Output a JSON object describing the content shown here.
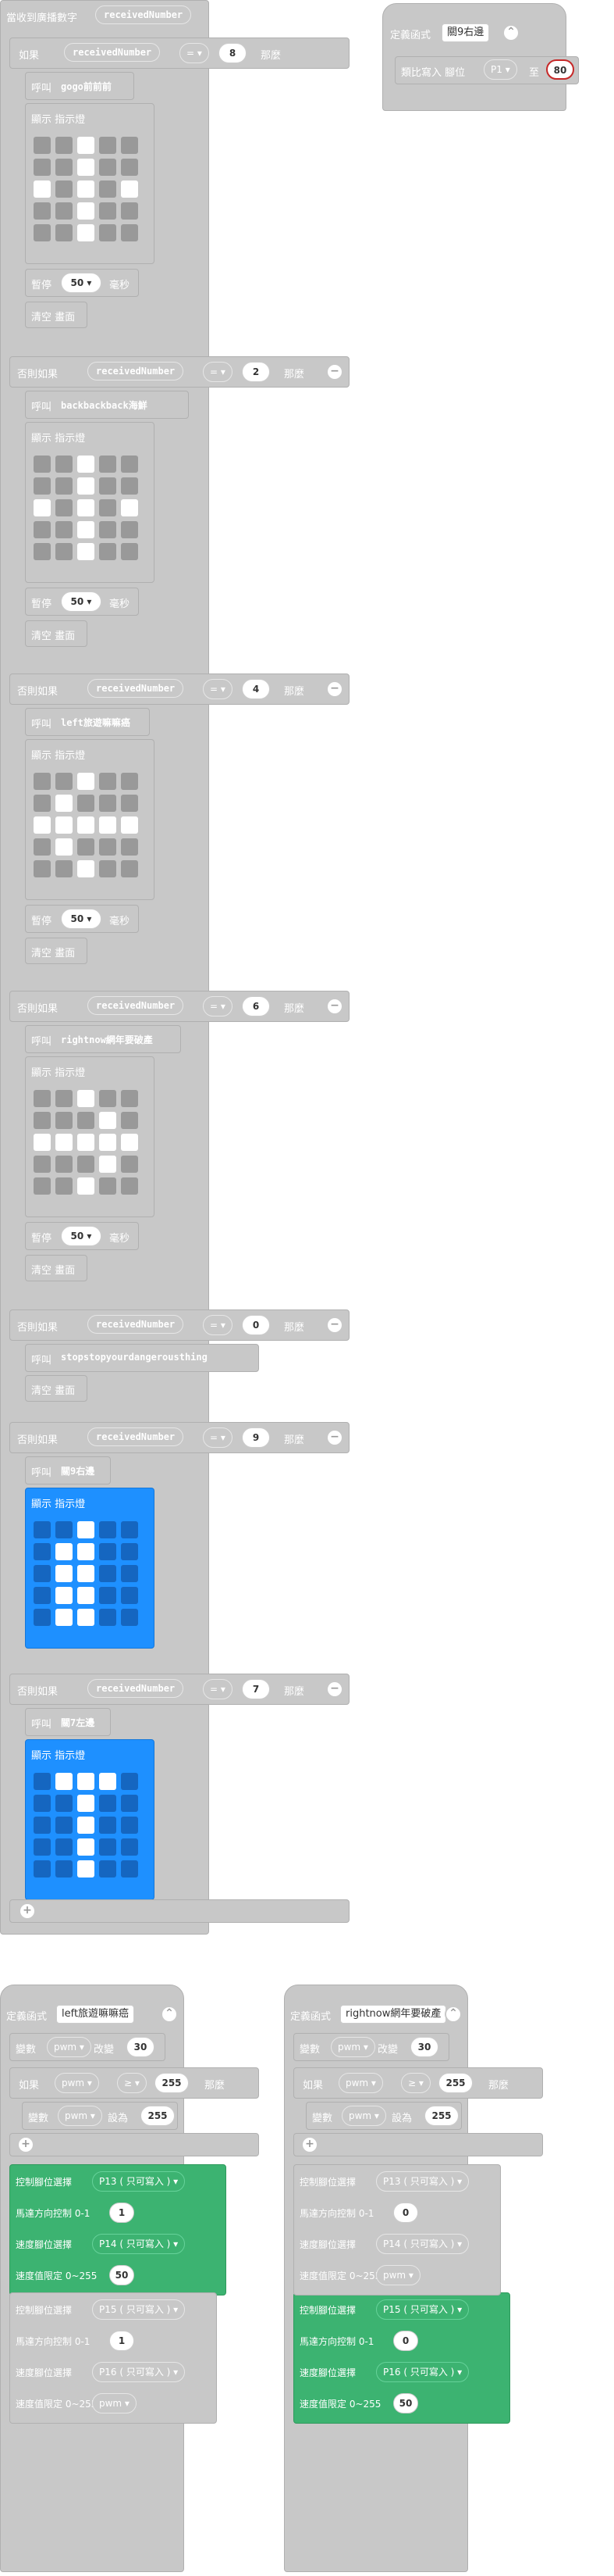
{
  "on_receive": {
    "label": "當收到廣播數字",
    "var": "receivedNumber"
  },
  "if_block": {
    "label": "如果",
    "then": "那麼",
    "op": "=",
    "var": "receivedNumber"
  },
  "else_if_label": "否則如果",
  "call_label": "呼叫",
  "show_leds_label": "顯示 指示燈",
  "pause_label": "暫停",
  "ms_label": "毫秒",
  "pause_value": "50",
  "clear_label": "清空 畫面",
  "branches": [
    {
      "value": "8",
      "call": "gogo前前前",
      "leds": "0010000100101010010000100"
    },
    {
      "value": "2",
      "call": "backbackback海鮮",
      "leds": "0010000100101010010000100"
    },
    {
      "value": "4",
      "call": "left旅遊嘛嘛癌",
      "leds": "0010001000111110100000100"
    },
    {
      "value": "6",
      "call": "rightnow網年要破產",
      "leds": "0010000010111110001000100"
    },
    {
      "value": "0",
      "call": "stopstopyourdangerousthing"
    },
    {
      "value": "9",
      "call": "關9右邊",
      "leds": "0010001100011000110001100"
    },
    {
      "value": "7",
      "call": "關7左邊",
      "leds": "0111000100001000010000100"
    }
  ],
  "func_def": {
    "label": "定義函式",
    "name": "關9右邊"
  },
  "analog_write": {
    "label": "類比寫入 腳位",
    "pin": "P1",
    "to": "至",
    "value": "80"
  },
  "left_func": {
    "label": "定義函式",
    "name": "left旅遊嘛嘛癌",
    "change": {
      "label": "變數",
      "var": "pwm",
      "mid": "改變",
      "value": "30"
    },
    "if": {
      "label": "如果",
      "var": "pwm",
      "op": "≥",
      "value": "255",
      "then": "那麼"
    },
    "set": {
      "label": "變數",
      "var": "pwm",
      "mid": "設為",
      "value": "255"
    },
    "rows": [
      {
        "label": "控制腳位選擇",
        "value": "P13 ( 只可寫入 )"
      },
      {
        "label": "馬達方向控制 0-1",
        "value": "1"
      },
      {
        "label": "速度腳位選擇",
        "value": "P14 ( 只可寫入 )"
      },
      {
        "label": "速度值限定 0~255",
        "value": "50"
      },
      {
        "label": "控制腳位選擇",
        "value": "P15 ( 只可寫入 )"
      },
      {
        "label": "馬達方向控制 0-1",
        "value": "1"
      },
      {
        "label": "速度腳位選擇",
        "value": "P16 ( 只可寫入 )"
      },
      {
        "label": "速度值限定 0~255",
        "value": "pwm"
      }
    ]
  },
  "right_func": {
    "label": "定義函式",
    "name": "rightnow網年要破產",
    "change": {
      "label": "變數",
      "var": "pwm",
      "mid": "改變",
      "value": "30"
    },
    "if": {
      "label": "如果",
      "var": "pwm",
      "op": "≥",
      "value": "255",
      "then": "那麼"
    },
    "set": {
      "label": "變數",
      "var": "pwm",
      "mid": "設為",
      "value": "255"
    },
    "rows": [
      {
        "label": "控制腳位選擇",
        "value": "P13 ( 只可寫入 )"
      },
      {
        "label": "馬達方向控制 0-1",
        "value": "0"
      },
      {
        "label": "速度腳位選擇",
        "value": "P14 ( 只可寫入 )"
      },
      {
        "label": "速度值限定 0~255",
        "value": "pwm"
      },
      {
        "label": "控制腳位選擇",
        "value": "P15 ( 只可寫入 )"
      },
      {
        "label": "馬達方向控制 0-1",
        "value": "0"
      },
      {
        "label": "速度腳位選擇",
        "value": "P16 ( 只可寫入 )"
      },
      {
        "label": "速度值限定 0~255",
        "value": "50"
      }
    ]
  }
}
